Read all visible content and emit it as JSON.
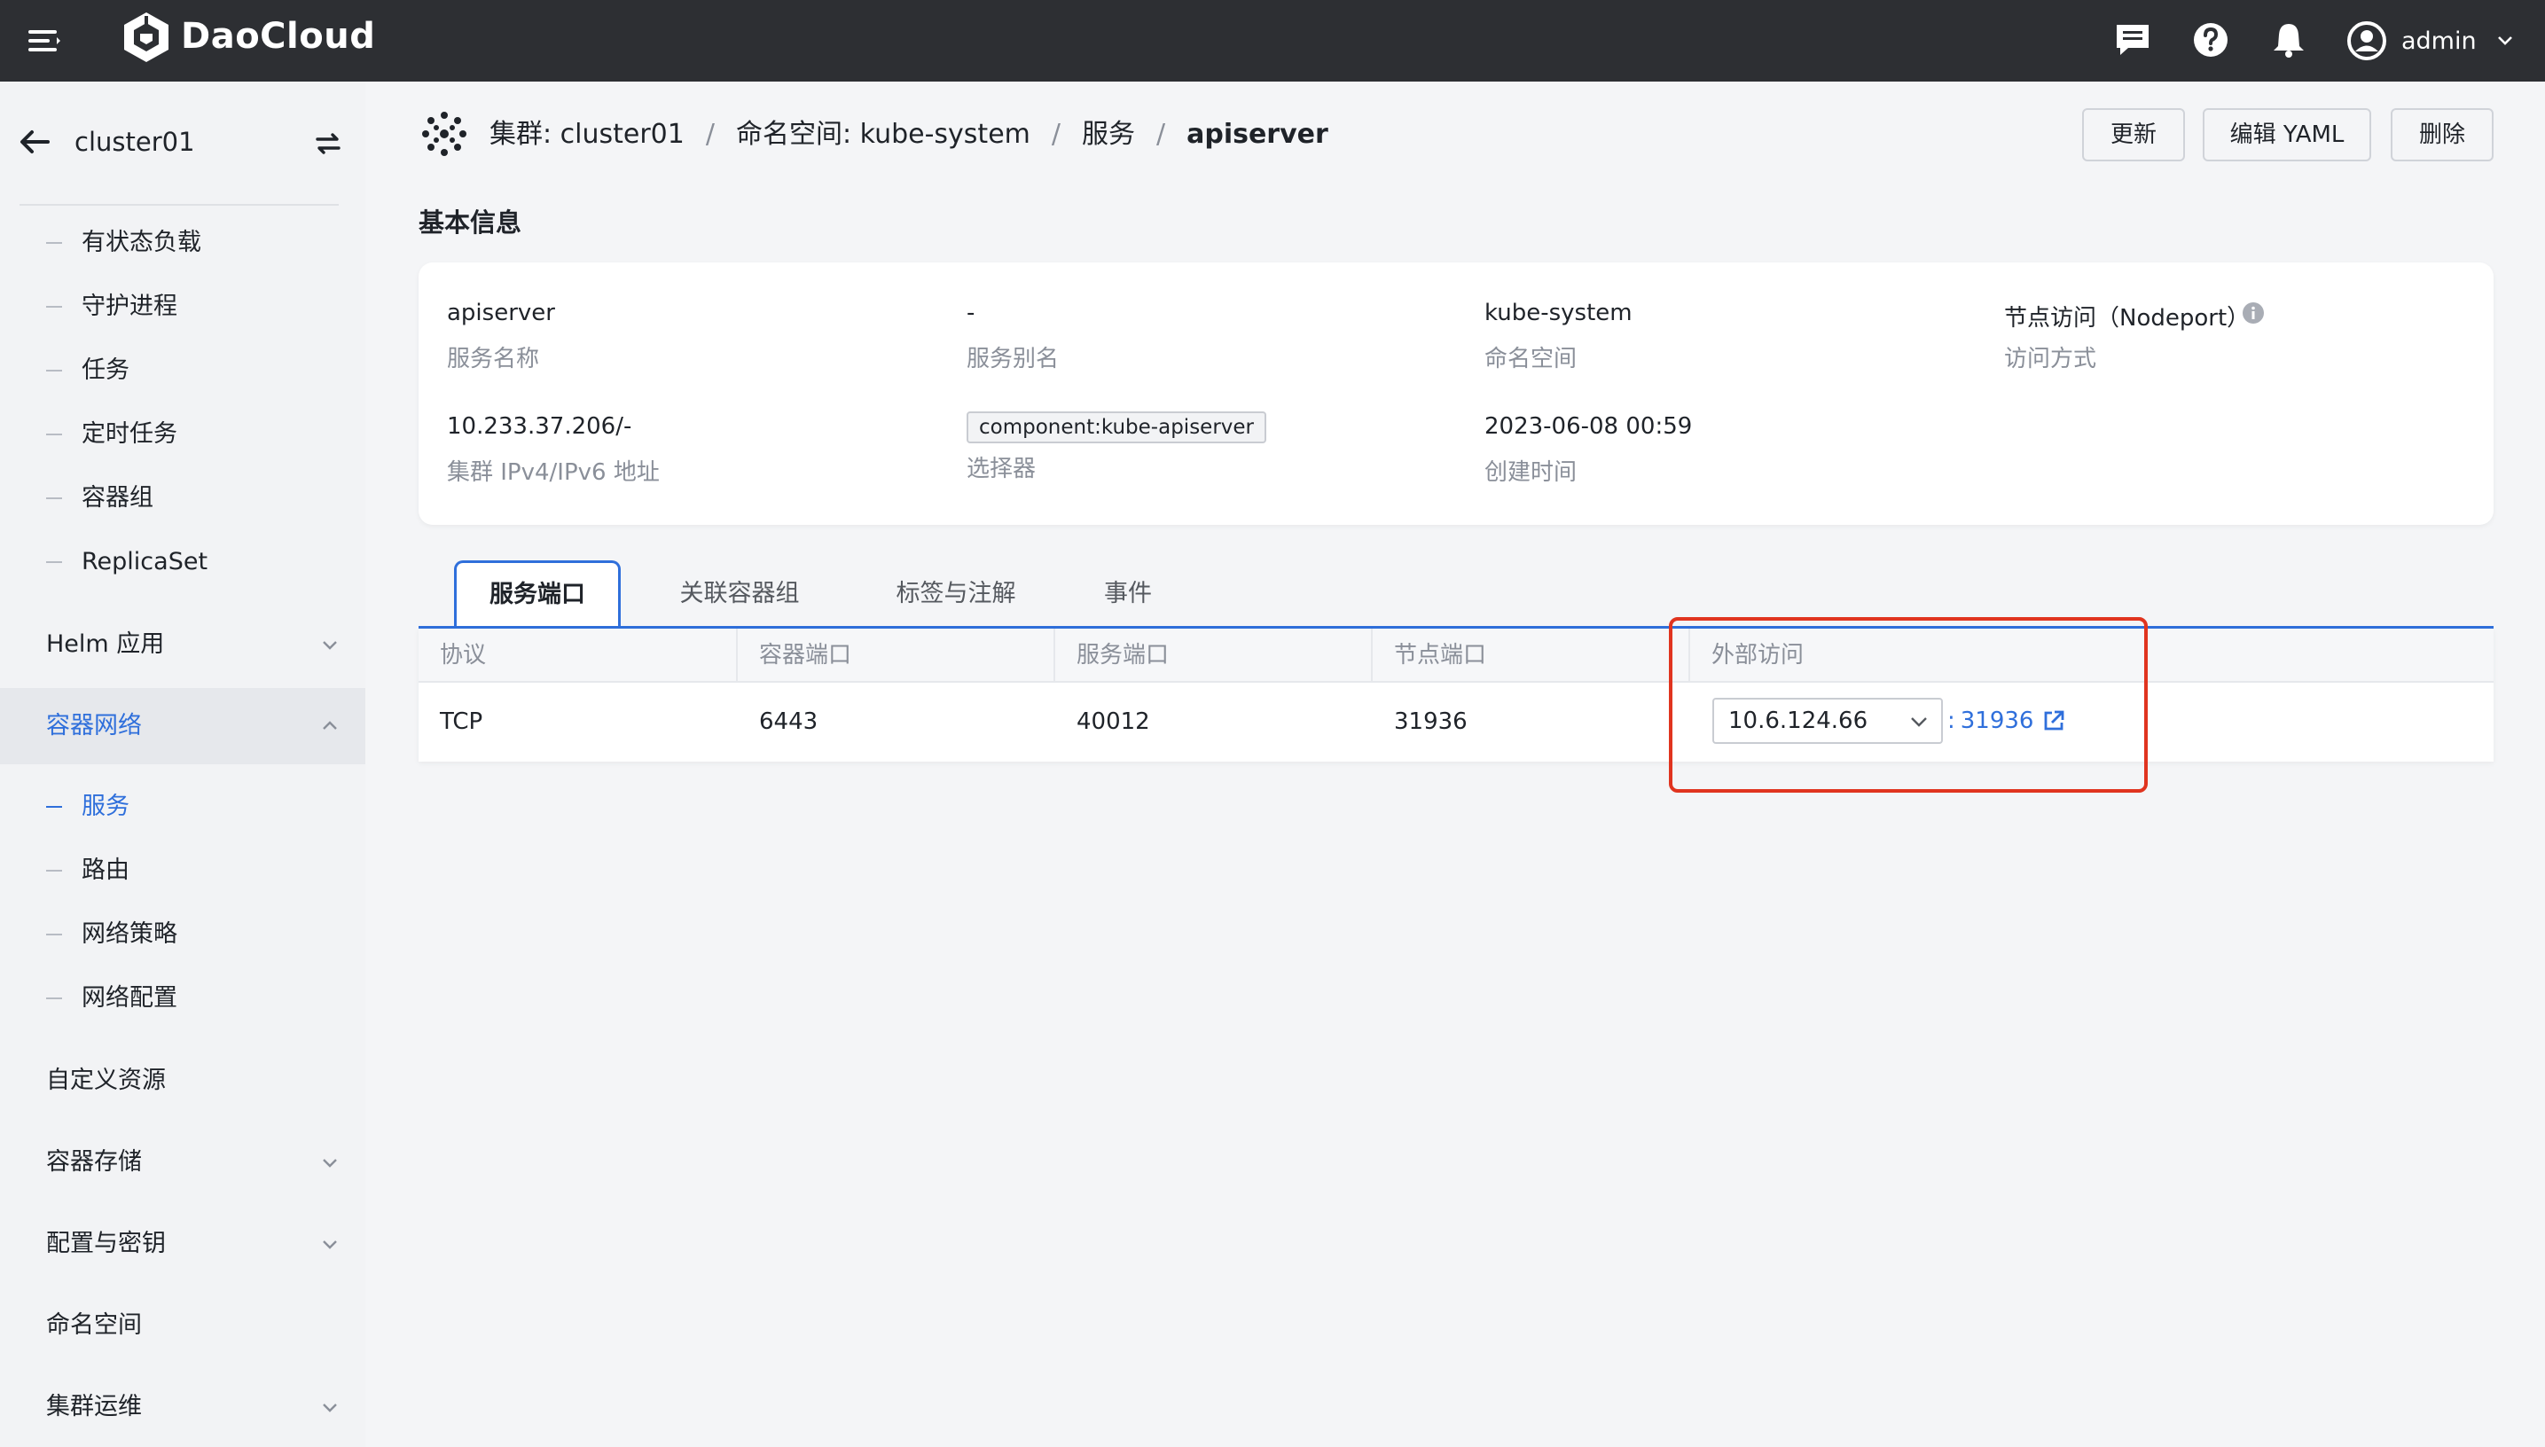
{
  "app": {
    "brand": "DaoCloud",
    "user": "admin"
  },
  "colors": {
    "accent": "#2f6fdb",
    "topbar": "#2d2f33",
    "highlight": "#e0341f"
  },
  "sidebar": {
    "cluster": "cluster01",
    "items": [
      {
        "label": "有状态负载",
        "type": "sub"
      },
      {
        "label": "守护进程",
        "type": "sub"
      },
      {
        "label": "任务",
        "type": "sub"
      },
      {
        "label": "定时任务",
        "type": "sub"
      },
      {
        "label": "容器组",
        "type": "sub"
      },
      {
        "label": "ReplicaSet",
        "type": "sub"
      },
      {
        "label": "Helm 应用",
        "type": "group",
        "chevron": "down"
      },
      {
        "label": "容器网络",
        "type": "group",
        "chevron": "up",
        "expanded": true
      },
      {
        "label": "服务",
        "type": "sub",
        "active": true
      },
      {
        "label": "路由",
        "type": "sub"
      },
      {
        "label": "网络策略",
        "type": "sub"
      },
      {
        "label": "网络配置",
        "type": "sub"
      },
      {
        "label": "自定义资源",
        "type": "group"
      },
      {
        "label": "容器存储",
        "type": "group",
        "chevron": "down"
      },
      {
        "label": "配置与密钥",
        "type": "group",
        "chevron": "down"
      },
      {
        "label": "命名空间",
        "type": "group"
      },
      {
        "label": "集群运维",
        "type": "group",
        "chevron": "down"
      }
    ]
  },
  "breadcrumb": [
    {
      "label": "集群:",
      "value": "cluster01"
    },
    {
      "label": "命名空间:",
      "value": "kube-system"
    },
    {
      "label": "服务"
    },
    {
      "label": "apiserver"
    }
  ],
  "actions": {
    "update": "更新",
    "edit_yaml": "编辑 YAML",
    "delete": "删除"
  },
  "basic_info": {
    "title": "基本信息",
    "service_name": {
      "value": "apiserver",
      "label": "服务名称"
    },
    "alias": {
      "value": "-",
      "label": "服务别名"
    },
    "namespace": {
      "value": "kube-system",
      "label": "命名空间"
    },
    "access_mode": {
      "value": "节点访问（Nodeport）",
      "label": "访问方式"
    },
    "cluster_ip": {
      "value": "10.233.37.206/-",
      "label": "集群 IPv4/IPv6 地址"
    },
    "selector": {
      "value": "component:kube-apiserver",
      "label": "选择器"
    },
    "created": {
      "value": "2023-06-08 00:59",
      "label": "创建时间"
    }
  },
  "tabs": [
    "服务端口",
    "关联容器组",
    "标签与注解",
    "事件"
  ],
  "ports_table": {
    "headers": [
      "协议",
      "容器端口",
      "服务端口",
      "节点端口",
      "外部访问"
    ],
    "rows": [
      {
        "protocol": "TCP",
        "container_port": "6443",
        "service_port": "40012",
        "node_port": "31936",
        "external_ip": "10.6.124.66",
        "external_port": "31936"
      }
    ]
  }
}
